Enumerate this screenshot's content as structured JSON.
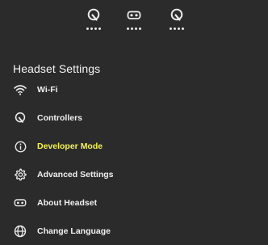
{
  "status_icons": [
    {
      "name": "controller-icon",
      "dots": 4
    },
    {
      "name": "headset-icon",
      "dots": 4
    },
    {
      "name": "controller-icon",
      "dots": 4
    }
  ],
  "section": {
    "title": "Headset Settings"
  },
  "menu": {
    "items": [
      {
        "label": "Wi-Fi",
        "icon": "wifi-icon"
      },
      {
        "label": "Controllers",
        "icon": "controller-icon"
      },
      {
        "label": "Developer Mode",
        "icon": "info-icon",
        "highlight_color": "#f3f34a"
      },
      {
        "label": "Advanced Settings",
        "icon": "gear-icon"
      },
      {
        "label": "About Headset",
        "icon": "headset-icon"
      },
      {
        "label": "Change Language",
        "icon": "globe-icon"
      }
    ]
  },
  "colors": {
    "background": "#2b2b2b",
    "text": "#f0f0f0",
    "highlight": "#f3f34a"
  }
}
